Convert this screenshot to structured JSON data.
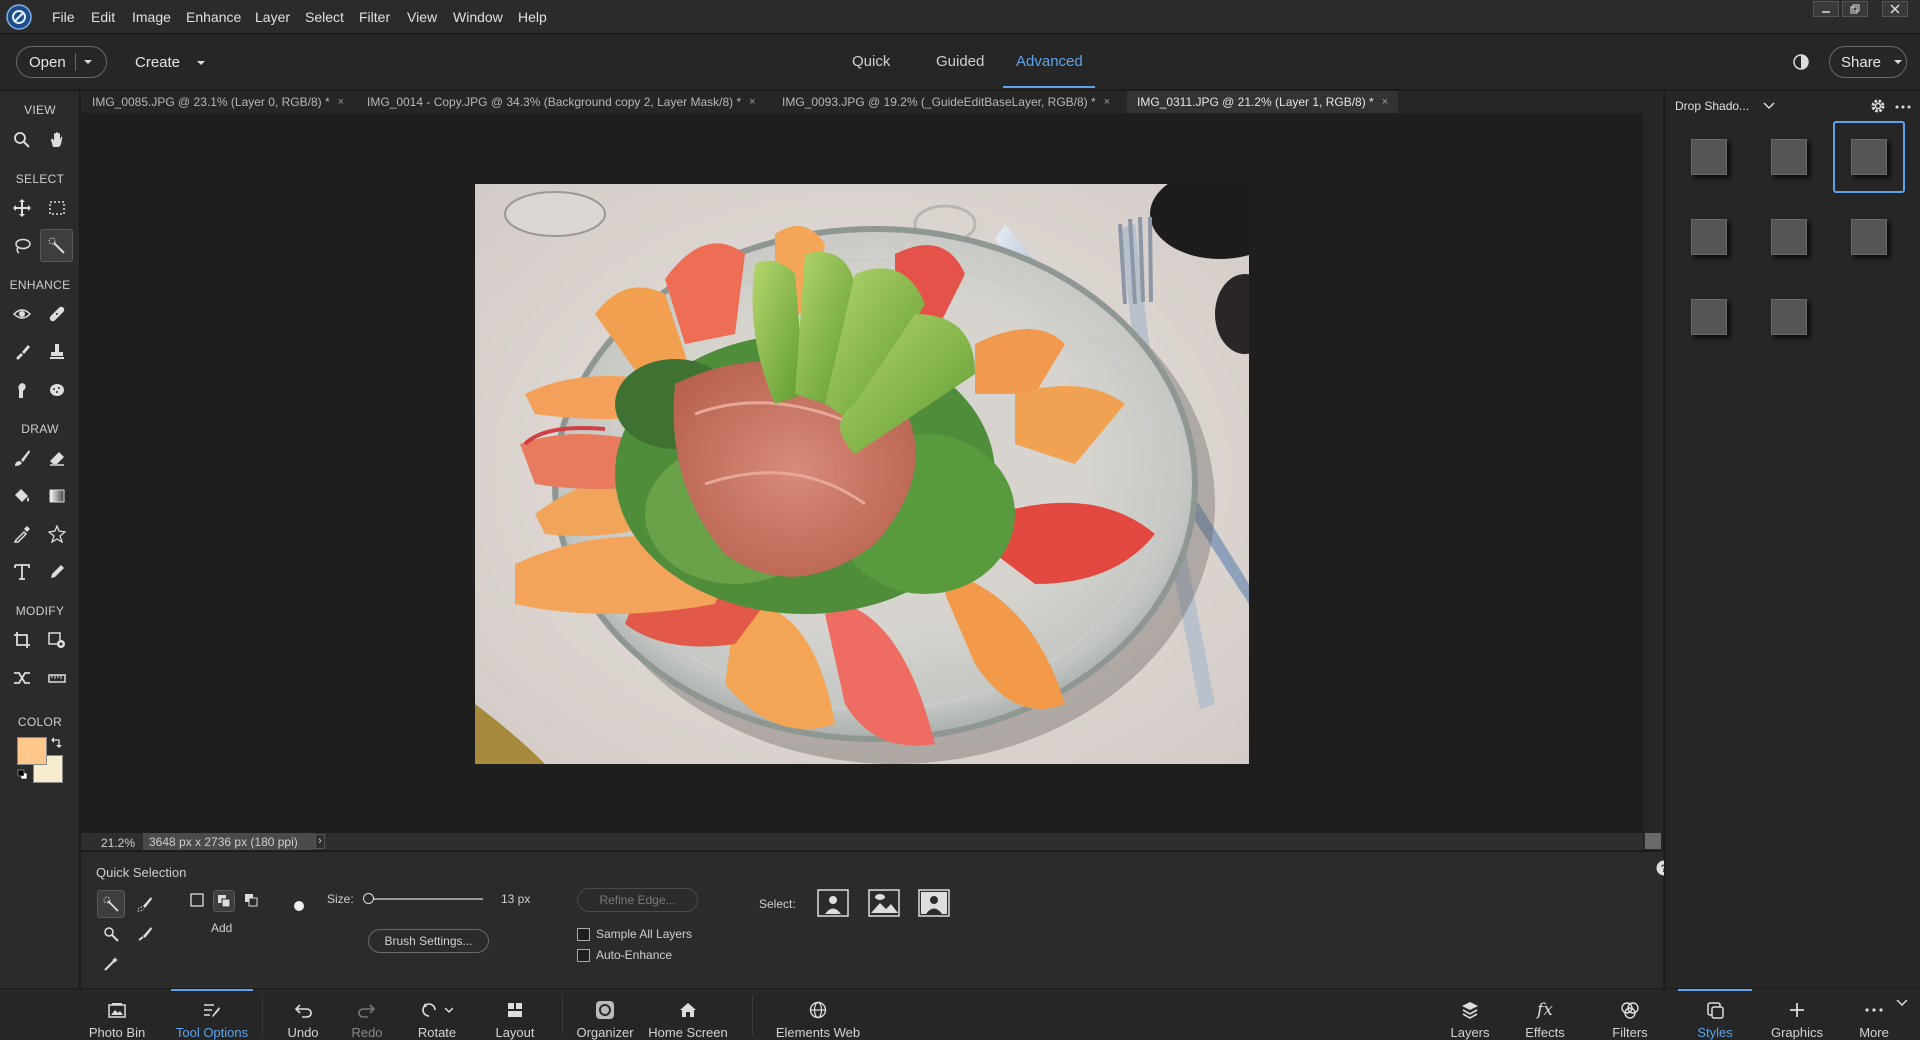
{
  "menubar": {
    "items": [
      "File",
      "Edit",
      "Image",
      "Enhance",
      "Layer",
      "Select",
      "Filter",
      "View",
      "Window",
      "Help"
    ]
  },
  "modebar": {
    "open_label": "Open",
    "create_label": "Create",
    "modes": [
      "Quick",
      "Guided",
      "Advanced"
    ],
    "active_mode": "Advanced",
    "share_label": "Share"
  },
  "toolbox": {
    "sections": [
      "VIEW",
      "SELECT",
      "ENHANCE",
      "DRAW",
      "MODIFY",
      "COLOR"
    ],
    "foreground_color": "#ffc78a",
    "background_color": "#f6ecce"
  },
  "doc_tabs": [
    {
      "label": "IMG_0085.JPG @ 23.1% (Layer 0, RGB/8) *",
      "close": "×"
    },
    {
      "label": "IMG_0014 - Copy.JPG @ 34.3% (Background copy 2, Layer Mask/8) *",
      "close": "×"
    },
    {
      "label": "IMG_0093.JPG @ 19.2% (_GuideEditBaseLayer, RGB/8) *",
      "close": "×"
    },
    {
      "label": "IMG_0311.JPG @ 21.2% (Layer 1, RGB/8) *",
      "close": "×"
    }
  ],
  "status": {
    "zoom": "21.2%",
    "doc_info": "3648 px x 2736 px (180 ppi)",
    "arrow": "›"
  },
  "tool_options": {
    "title": "Quick Selection",
    "mode_label": "Add",
    "size_label": "Size:",
    "size_value": "13 px",
    "size_slider_fraction": 0.04,
    "brush_settings": "Brush Settings...",
    "refine_edge": "Refine Edge...",
    "sample_all_layers": "Sample All Layers",
    "auto_enhance": "Auto-Enhance",
    "select_label": "Select:"
  },
  "right_panel": {
    "dropdown_label": "Drop Shado...",
    "style_count": 8,
    "selected_index": 2
  },
  "bottombar": {
    "left": [
      {
        "label": "Photo Bin",
        "icon": "photo-bin-icon"
      },
      {
        "label": "Tool Options",
        "icon": "tool-options-icon",
        "active": true
      },
      {
        "label": "Undo",
        "icon": "undo-icon"
      },
      {
        "label": "Redo",
        "icon": "redo-icon",
        "disabled": true
      },
      {
        "label": "Rotate",
        "icon": "rotate-icon"
      },
      {
        "label": "Layout",
        "icon": "layout-icon"
      },
      {
        "label": "Organizer",
        "icon": "organizer-icon"
      },
      {
        "label": "Home Screen",
        "icon": "home-icon"
      },
      {
        "label": "Elements Web",
        "icon": "globe-icon"
      }
    ],
    "right": [
      {
        "label": "Layers",
        "icon": "layers-icon"
      },
      {
        "label": "Effects",
        "icon": "fx-icon"
      },
      {
        "label": "Filters",
        "icon": "filters-icon"
      },
      {
        "label": "Styles",
        "icon": "styles-icon",
        "active": true
      },
      {
        "label": "Graphics",
        "icon": "plus-icon"
      },
      {
        "label": "More",
        "icon": "more-icon"
      }
    ]
  },
  "colors": {
    "accent": "#5ba4ec"
  }
}
